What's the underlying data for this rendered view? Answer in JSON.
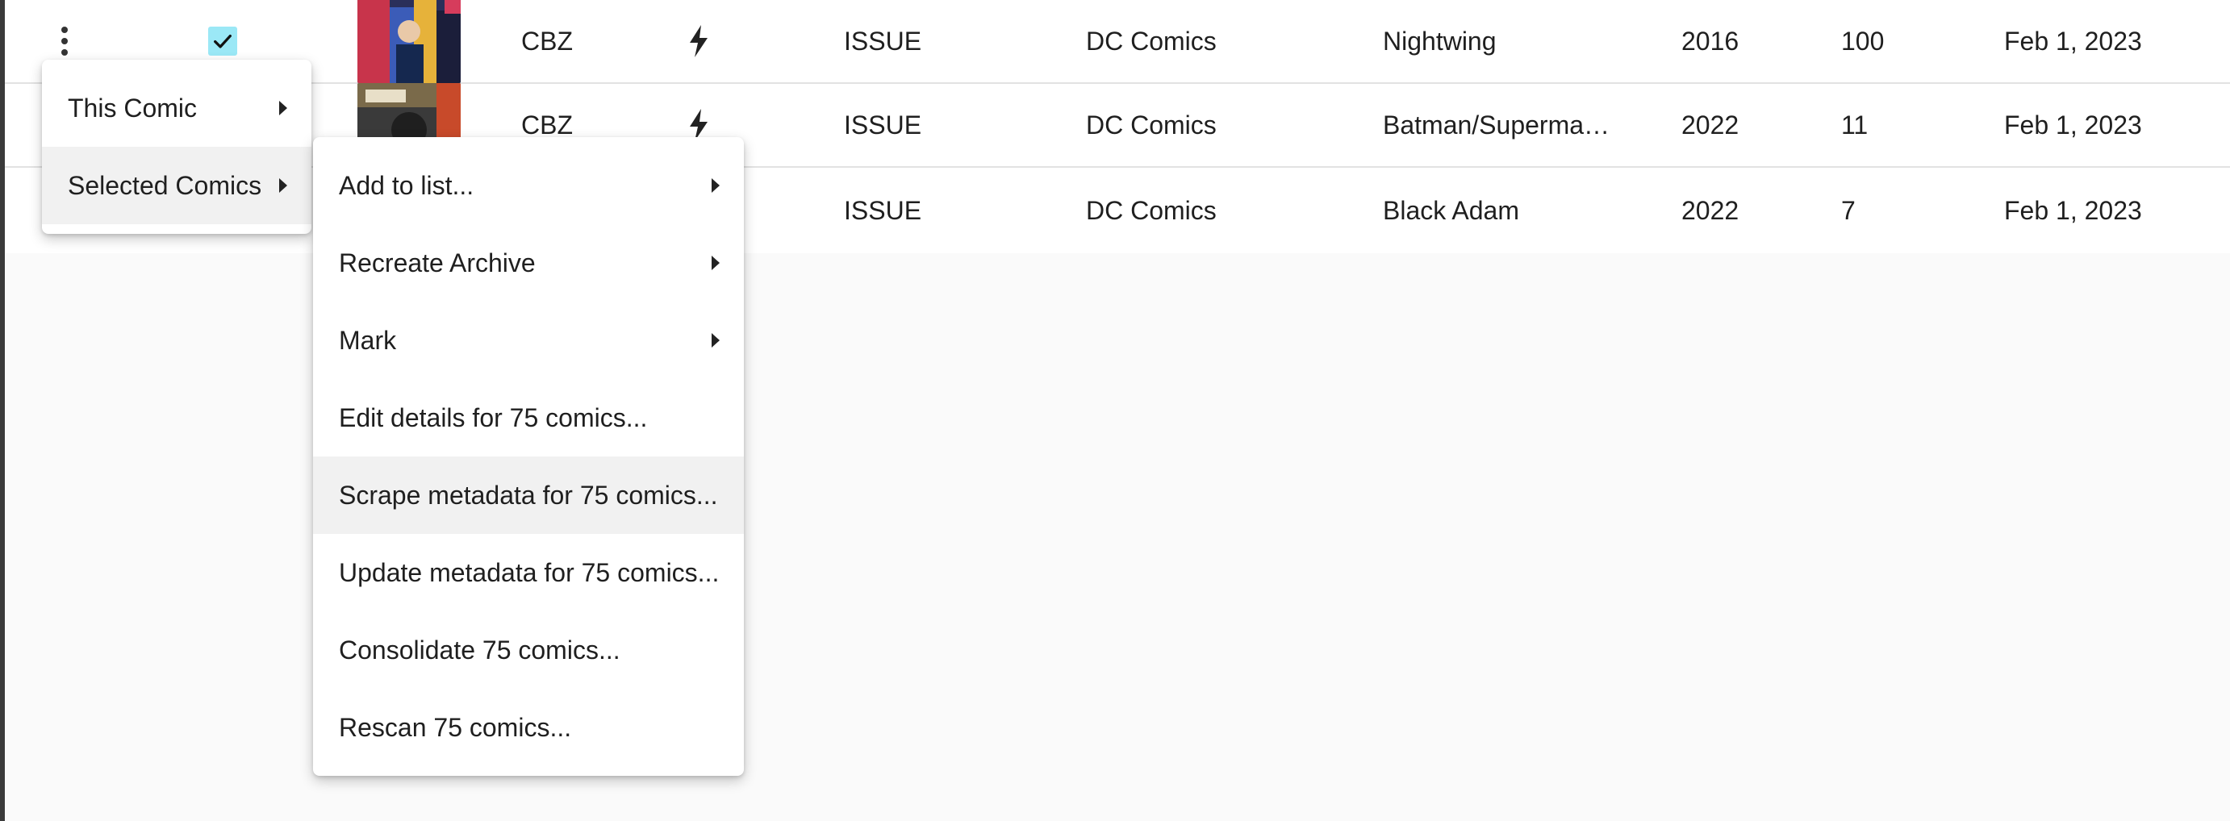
{
  "table": {
    "rows": [
      {
        "format": "CBZ",
        "type": "ISSUE",
        "publisher": "DC Comics",
        "series": "Nightwing",
        "year": "2016",
        "issue": "100",
        "date": "Feb 1, 2023"
      },
      {
        "format": "CBZ",
        "type": "ISSUE",
        "publisher": "DC Comics",
        "series": "Batman/Superma…",
        "year": "2022",
        "issue": "11",
        "date": "Feb 1, 2023"
      },
      {
        "format": "",
        "type": "ISSUE",
        "publisher": "DC Comics",
        "series": "Black Adam",
        "year": "2022",
        "issue": "7",
        "date": "Feb 1, 2023"
      }
    ]
  },
  "icons": {
    "row_menu": "kebab-icon",
    "selected": "checkmark-icon",
    "quick_action": "lightning-bolt-icon",
    "submenu": "caret-right-icon"
  },
  "colors": {
    "checkbox": "#9be8f6",
    "highlight": "#f1f1f1",
    "background": "#fafafa"
  },
  "context_menu": {
    "items": [
      {
        "label": "This Comic"
      },
      {
        "label": "Selected Comics"
      }
    ]
  },
  "submenu": {
    "items": [
      {
        "label": "Add to list..."
      },
      {
        "label": "Recreate Archive"
      },
      {
        "label": "Mark"
      },
      {
        "label": "Edit details for 75 comics..."
      },
      {
        "label": "Scrape metadata for 75 comics..."
      },
      {
        "label": "Update metadata for 75 comics..."
      },
      {
        "label": "Consolidate 75 comics..."
      },
      {
        "label": "Rescan 75 comics..."
      }
    ]
  }
}
